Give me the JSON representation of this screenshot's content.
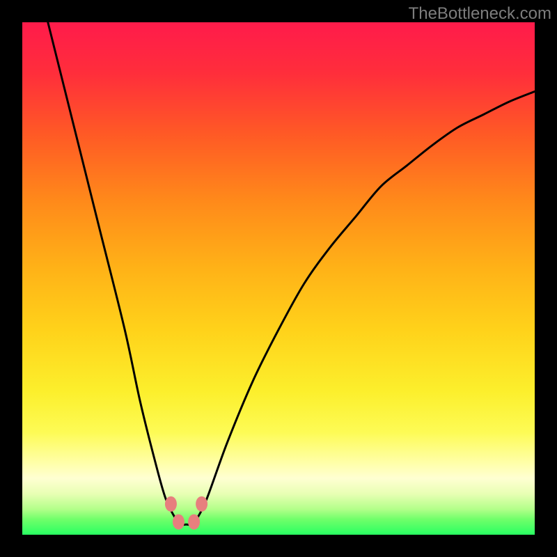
{
  "watermark": {
    "text": "TheBottleneck.com"
  },
  "gradient": {
    "stops": [
      {
        "offset": 0.0,
        "color": "#ff1b4b"
      },
      {
        "offset": 0.1,
        "color": "#ff2e3b"
      },
      {
        "offset": 0.22,
        "color": "#ff5a25"
      },
      {
        "offset": 0.35,
        "color": "#ff8a1a"
      },
      {
        "offset": 0.48,
        "color": "#ffb217"
      },
      {
        "offset": 0.6,
        "color": "#ffd21a"
      },
      {
        "offset": 0.72,
        "color": "#fcef2c"
      },
      {
        "offset": 0.8,
        "color": "#fdfb55"
      },
      {
        "offset": 0.86,
        "color": "#ffffa9"
      },
      {
        "offset": 0.89,
        "color": "#ffffd2"
      },
      {
        "offset": 0.92,
        "color": "#e8ffb4"
      },
      {
        "offset": 0.95,
        "color": "#b3ff8a"
      },
      {
        "offset": 0.97,
        "color": "#70ff6a"
      },
      {
        "offset": 1.0,
        "color": "#29ff62"
      }
    ]
  },
  "chart_data": {
    "type": "line",
    "title": "",
    "xlabel": "",
    "ylabel": "",
    "xlim": [
      0,
      100
    ],
    "ylim": [
      0,
      100
    ],
    "series": [
      {
        "name": "bottleneck-curve",
        "x": [
          5,
          10,
          15,
          20,
          23,
          26,
          28,
          30,
          31,
          32,
          33,
          34,
          36,
          40,
          45,
          50,
          55,
          60,
          65,
          70,
          75,
          80,
          85,
          90,
          95,
          100
        ],
        "y": [
          100,
          80,
          60,
          40,
          26,
          14,
          7,
          3,
          2,
          2,
          2,
          3,
          7,
          18,
          30,
          40,
          49,
          56,
          62,
          68,
          72,
          76,
          79.5,
          82,
          84.5,
          86.5
        ]
      }
    ],
    "markers": [
      {
        "name": "marker-left-upper",
        "x": 29.0,
        "y": 6.0
      },
      {
        "name": "marker-left-lower",
        "x": 30.5,
        "y": 2.5
      },
      {
        "name": "marker-right-lower",
        "x": 33.5,
        "y": 2.5
      },
      {
        "name": "marker-right-upper",
        "x": 35.0,
        "y": 6.0
      }
    ],
    "marker_style": {
      "color": "#e77f7e",
      "radius_px": 10
    }
  }
}
